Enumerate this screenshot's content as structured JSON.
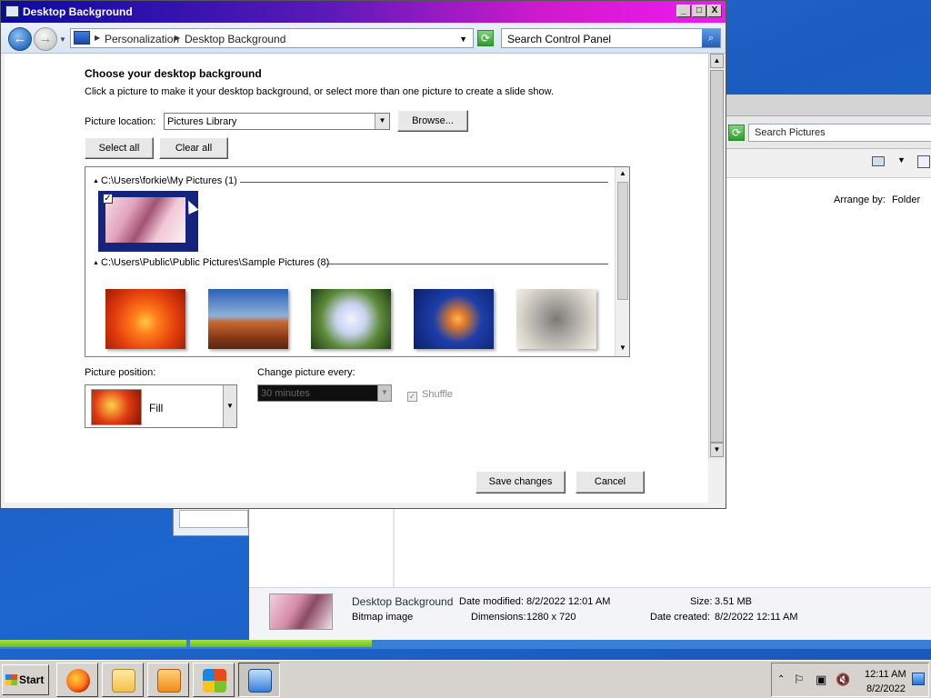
{
  "window": {
    "title": "Desktop Background",
    "controls": {
      "minimize": "_",
      "maximize": "□",
      "close": "X"
    }
  },
  "navigation": {
    "breadcrumb": [
      "Personalization",
      "Desktop Background"
    ],
    "search_placeholder": "Search Control Panel"
  },
  "content": {
    "heading": "Choose your desktop background",
    "description": "Click a picture to make it your desktop background, or select more than one picture to create a slide show.",
    "picture_location_label": "Picture location:",
    "picture_location_value": "Pictures Library",
    "browse_label": "Browse...",
    "select_all_label": "Select all",
    "clear_all_label": "Clear all",
    "groups": [
      {
        "header": "C:\\Users\\forkie\\My Pictures (1)",
        "checked": true
      },
      {
        "header": "C:\\Users\\Public\\Public Pictures\\Sample Pictures (8)"
      }
    ],
    "picture_position_label": "Picture position:",
    "picture_position_value": "Fill",
    "change_picture_label": "Change picture every:",
    "change_picture_value": "30 minutes",
    "shuffle_label": "Shuffle",
    "save_label": "Save changes",
    "cancel_label": "Cancel"
  },
  "explorer": {
    "search_placeholder": "Search Pictures",
    "arrange_label": "Arrange by:",
    "arrange_value": "Folder",
    "details": {
      "name": "Desktop Background",
      "type": "Bitmap image",
      "date_modified_label": "Date modified:",
      "date_modified": "8/2/2022 12:01 AM",
      "dimensions_label": "Dimensions:",
      "dimensions": "1280 x 720",
      "size_label": "Size:",
      "size": "3.51 MB",
      "date_created_label": "Date created:",
      "date_created": "8/2/2022 12:11 AM"
    }
  },
  "taskbar": {
    "start_label": "Start",
    "clock_time": "12:11 AM",
    "clock_date": "8/2/2022"
  }
}
